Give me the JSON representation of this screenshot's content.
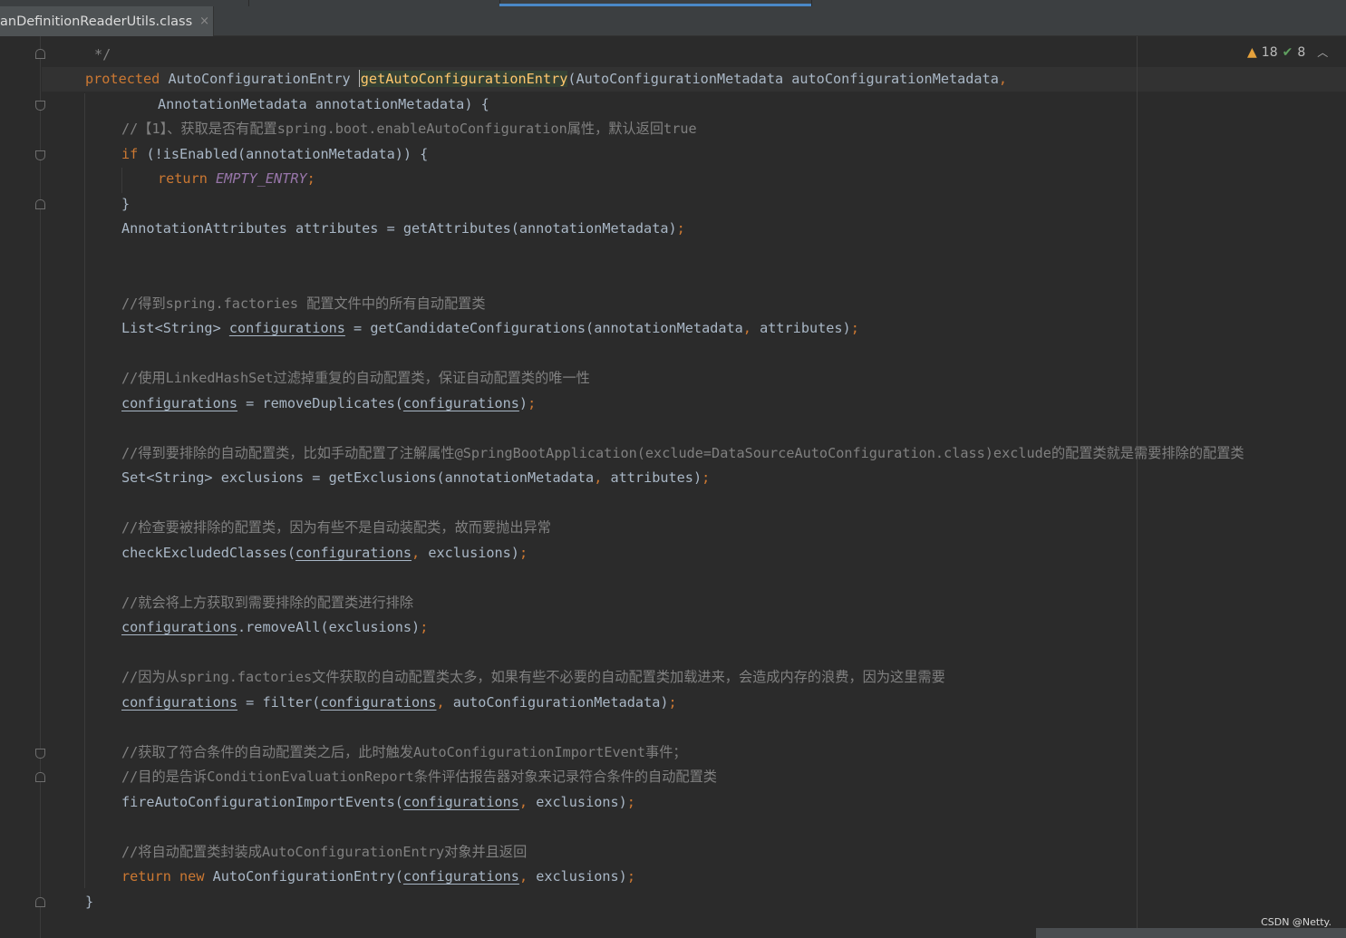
{
  "tab": {
    "label": "anDefinitionReaderUtils.class",
    "close_symbol": "×"
  },
  "indicators": {
    "warnings": "18",
    "checks": "8"
  },
  "watermark": "CSDN @Netty.",
  "code": {
    "l0_cmt": "*/",
    "l1_kw": "protected",
    "l1_type": "AutoConfigurationEntry",
    "l1_method": "getAutoConfigurationEntry",
    "l1_params": "(AutoConfigurationMetadata autoConfigurationMetadata",
    "l1_comma": ",",
    "l2_text": "AnnotationMetadata annotationMetadata) {",
    "l3_cmt": "//【1】、获取是否有配置spring.boot.enableAutoConfiguration属性，默认返回true",
    "l4_kw": "if",
    "l4_text": " (!isEnabled(annotationMetadata)) {",
    "l5_kw": "return",
    "l5_field": "EMPTY_ENTRY",
    "l5_semi": ";",
    "l6_text": "}",
    "l7_text": "AnnotationAttributes attributes = getAttributes(annotationMetadata)",
    "l7_semi": ";",
    "l10_cmt": "//得到spring.factories 配置文件中的所有自动配置类",
    "l11_a": "List<String> ",
    "l11_var": "configurations",
    "l11_b": " = getCandidateConfigurations(annotationMetadata",
    "l11_comma": ",",
    "l11_c": " attributes)",
    "l11_semi": ";",
    "l13_cmt": "//使用LinkedHashSet过滤掉重复的自动配置类，保证自动配置类的唯一性",
    "l14_var": "configurations",
    "l14_a": " = removeDuplicates(",
    "l14_var2": "configurations",
    "l14_b": ")",
    "l14_semi": ";",
    "l16_cmt": "//得到要排除的自动配置类，比如手动配置了注解属性@SpringBootApplication(exclude=DataSourceAutoConfiguration.class)exclude的配置类就是需要排除的配置类",
    "l17_a": "Set<String> exclusions = getExclusions(annotationMetadata",
    "l17_comma": ",",
    "l17_b": " attributes)",
    "l17_semi": ";",
    "l19_cmt": "//检查要被排除的配置类，因为有些不是自动装配类，故而要抛出异常",
    "l20_a": "checkExcludedClasses(",
    "l20_var": "configurations",
    "l20_comma": ",",
    "l20_b": " exclusions)",
    "l20_semi": ";",
    "l22_cmt": "//就会将上方获取到需要排除的配置类进行排除",
    "l23_var": "configurations",
    "l23_a": ".removeAll(exclusions)",
    "l23_semi": ";",
    "l25_cmt": "//因为从spring.factories文件获取的自动配置类太多，如果有些不必要的自动配置类加载进来，会造成内存的浪费，因为这里需要",
    "l26_var": "configurations",
    "l26_a": " = filter(",
    "l26_var2": "configurations",
    "l26_comma": ",",
    "l26_b": " autoConfigurationMetadata)",
    "l26_semi": ";",
    "l28_cmt": "//获取了符合条件的自动配置类之后，此时触发AutoConfigurationImportEvent事件；",
    "l29_cmt": "//目的是告诉ConditionEvaluationReport条件评估报告器对象来记录符合条件的自动配置类",
    "l30_a": "fireAutoConfigurationImportEvents(",
    "l30_var": "configurations",
    "l30_comma": ",",
    "l30_b": " exclusions)",
    "l30_semi": ";",
    "l32_cmt": "//将自动配置类封装成AutoConfigurationEntry对象并且返回",
    "l33_kw": "return",
    "l33_kw2": "new",
    "l33_a": " AutoConfigurationEntry(",
    "l33_var": "configurations",
    "l33_comma": ",",
    "l33_b": " exclusions)",
    "l33_semi": ";",
    "l34_text": "}"
  }
}
